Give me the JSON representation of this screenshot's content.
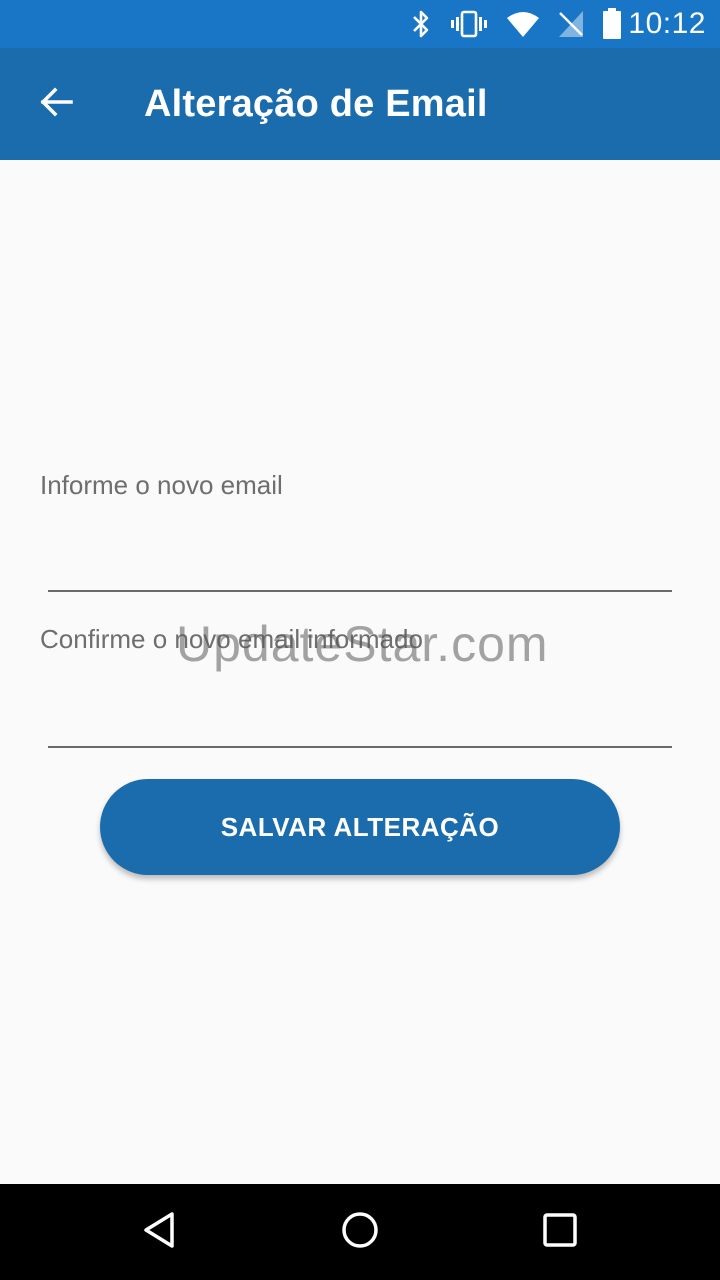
{
  "status_bar": {
    "time": "10:12",
    "icons": [
      "bluetooth-icon",
      "vibrate-icon",
      "wifi-icon",
      "no-signal-icon",
      "battery-icon"
    ]
  },
  "app_bar": {
    "title": "Alteração de Email",
    "back_icon": "arrow-back-icon",
    "color": "#1a6cad"
  },
  "form": {
    "new_email": {
      "label": "Informe o novo email",
      "value": ""
    },
    "confirm_email": {
      "label": "Confirme o novo email informado",
      "value": ""
    },
    "save_label": "SALVAR ALTERAÇÃO"
  },
  "watermark": "UpdateStar.com",
  "nav_bar": {
    "icons": [
      "back-triangle-icon",
      "home-circle-icon",
      "recents-square-icon"
    ]
  },
  "colors": {
    "status_bar": "#1976c7",
    "primary": "#1a6cad",
    "background": "#fafafa"
  }
}
